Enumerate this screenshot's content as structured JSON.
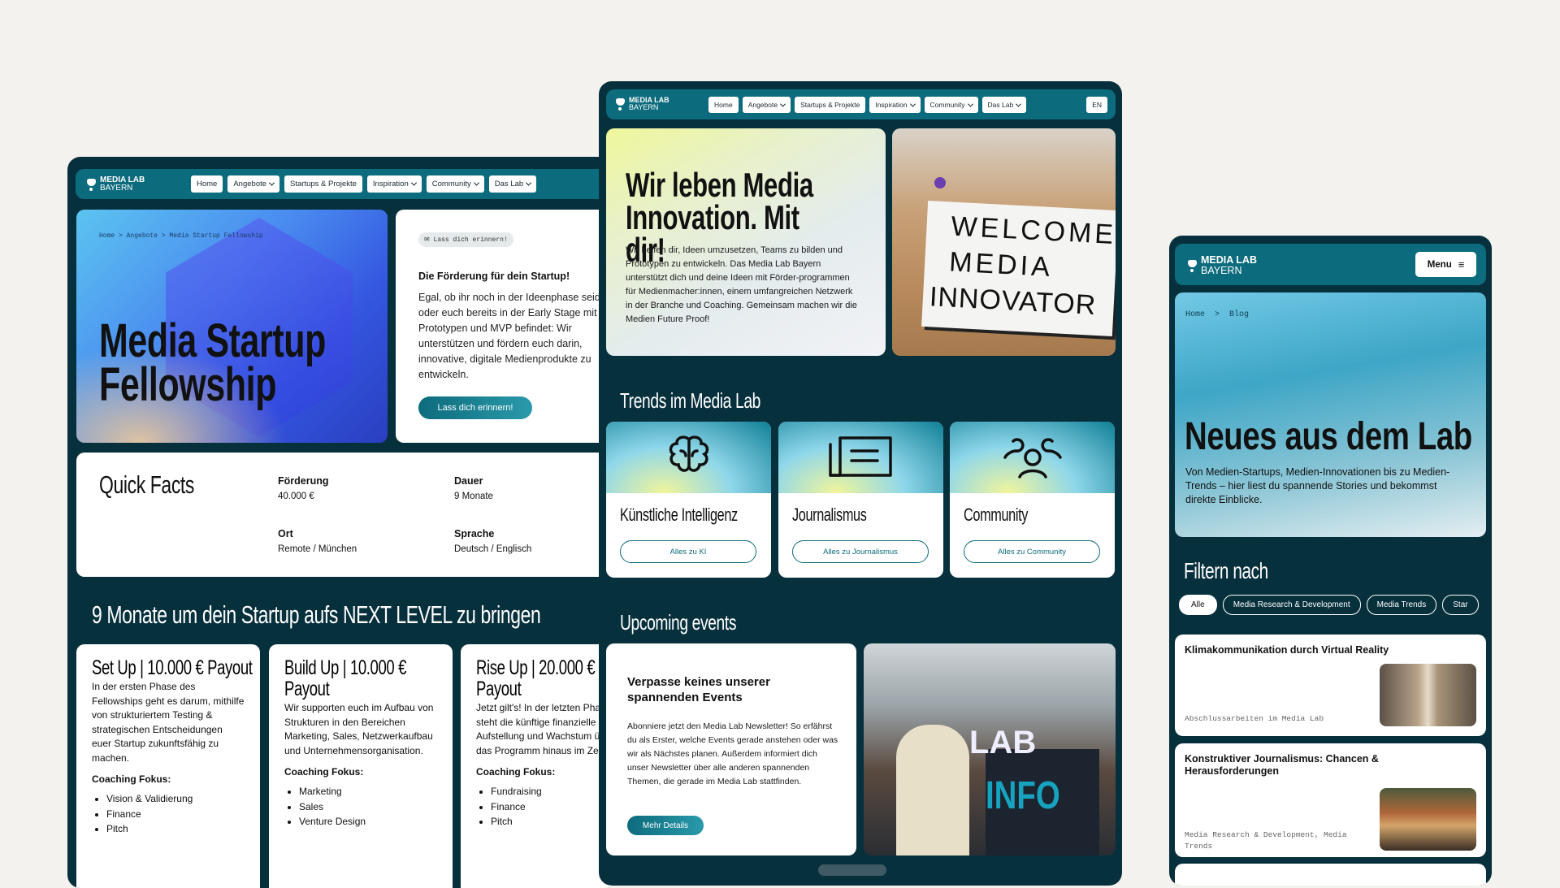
{
  "brand": {
    "line1": "MEDIA LAB",
    "line2": "BAYERN"
  },
  "colors": {
    "page_bg": "#f3f2ee",
    "frame_bg": "#07303d",
    "nav_bg": "#0c6b7c",
    "accent": "#0d6b7c"
  },
  "nav": {
    "items": [
      "Home",
      "Angebote",
      "Startups & Projekte",
      "Inspiration",
      "Community",
      "Das Lab"
    ],
    "language": "EN",
    "mobile_menu": "Menu"
  },
  "fellowship_page": {
    "breadcrumb": [
      "Home",
      "Angebote",
      "Media Startup Fellowship"
    ],
    "title": "Media Startup Fellowship",
    "reminder_tag": "Lass dich erinnern!",
    "intro_heading": "Die Förderung für dein Startup!",
    "intro_text": "Egal, ob ihr noch in der Ideenphase seid oder euch bereits in der Early Stage mit Prototypen und MVP befindet: Wir unterstützen und fördern euch darin, innovative, digitale Medienprodukte zu entwickeln.",
    "reminder_button": "Lass dich erinnern!",
    "quick_facts": {
      "title": "Quick Facts",
      "facts": [
        {
          "label": "Förderung",
          "value": "40.000 €"
        },
        {
          "label": "Dauer",
          "value": "9 Monate"
        },
        {
          "label": "Ort",
          "value": "Remote / München"
        },
        {
          "label": "Sprache",
          "value": "Deutsch / Englisch"
        }
      ]
    },
    "phases_heading": "9 Monate um dein Startup aufs NEXT LEVEL zu bringen",
    "phases": [
      {
        "title": "Set Up | 10.000 € Payout",
        "text": "In der ersten Phase des Fellowships geht es darum, mithilfe von strukturiertem Testing & strategischen Entscheidungen euer Startup zukunftsfähig zu machen.",
        "focus_label": "Coaching Fokus:",
        "focus": [
          "Vision & Validierung",
          "Finance",
          "Pitch"
        ]
      },
      {
        "title": "Build Up | 10.000 € Payout",
        "text": "Wir supporten euch im Aufbau von Strukturen in den Bereichen Marketing, Sales, Netzwerkaufbau und Unternehmensorganisation.",
        "focus_label": "Coaching Fokus:",
        "focus": [
          "Marketing",
          "Sales",
          "Venture Design"
        ]
      },
      {
        "title": "Rise Up | 20.000 € Payout",
        "text": "Jetzt gilt's! In der letzten Phase steht die künftige finanzielle Aufstellung und Wachstum über das Programm hinaus im Zentrum.",
        "focus_label": "Coaching Fokus:",
        "focus": [
          "Fundraising",
          "Finance",
          "Pitch"
        ]
      }
    ]
  },
  "home_page": {
    "hero_title": "Wir leben Media Innovation. Mit dir!",
    "hero_text": "Wir helfen dir, Ideen umzusetzen, Teams zu bilden und Prototypen zu entwickeln. Das Media Lab Bayern unterstützt dich und deine Ideen mit Förder-programmen für Medienmacher:innen, einem umfangreichen Netzwerk in der Branche und Coaching. Gemeinsam machen wir die Medien Future Proof!",
    "hero_sign": [
      "WELCOME",
      "MEDIA",
      "INNOVATOR"
    ],
    "trends_heading": "Trends im Media Lab",
    "trends": [
      {
        "icon": "brain-icon",
        "title": "Künstliche Intelligenz",
        "button": "Alles zu KI"
      },
      {
        "icon": "newspaper-icon",
        "title": "Journalismus",
        "button": "Alles zu Journalismus"
      },
      {
        "icon": "people-icon",
        "title": "Community",
        "button": "Alles zu Community"
      }
    ],
    "events_heading": "Upcoming events",
    "event_title": "Verpasse keines unserer spannenden Events",
    "event_text": "Abonniere jetzt den Media Lab Newsletter! So erfährst du als Erster, welche Events gerade anstehen oder was wir als Nächstes planen. Außerdem informiert dich unser Newsletter über alle anderen spannenden Themen, die gerade im Media Lab stattfinden.",
    "event_button": "Mehr Details",
    "event_photo_sign": [
      "LAB",
      "INFO"
    ]
  },
  "blog_page": {
    "breadcrumb": [
      "Home",
      "Blog"
    ],
    "title": "Neues aus dem Lab",
    "intro": "Von Medien-Startups, Medien-Innovationen bis zu Medien-Trends – hier liest du spannende Stories und bekommst direkte Einblicke.",
    "filter_heading": "Filtern nach",
    "filters": [
      "Alle",
      "Media Research & Development",
      "Media Trends",
      "Star"
    ],
    "active_filter": "Alle",
    "articles": [
      {
        "title": "Klimakommunikation durch Virtual Reality",
        "tags": "Abschlussarbeiten im Media Lab"
      },
      {
        "title": "Konstruktiver Journalismus: Chancen & Herausforderungen",
        "tags": "Media Research & Development, Media Trends"
      }
    ]
  }
}
